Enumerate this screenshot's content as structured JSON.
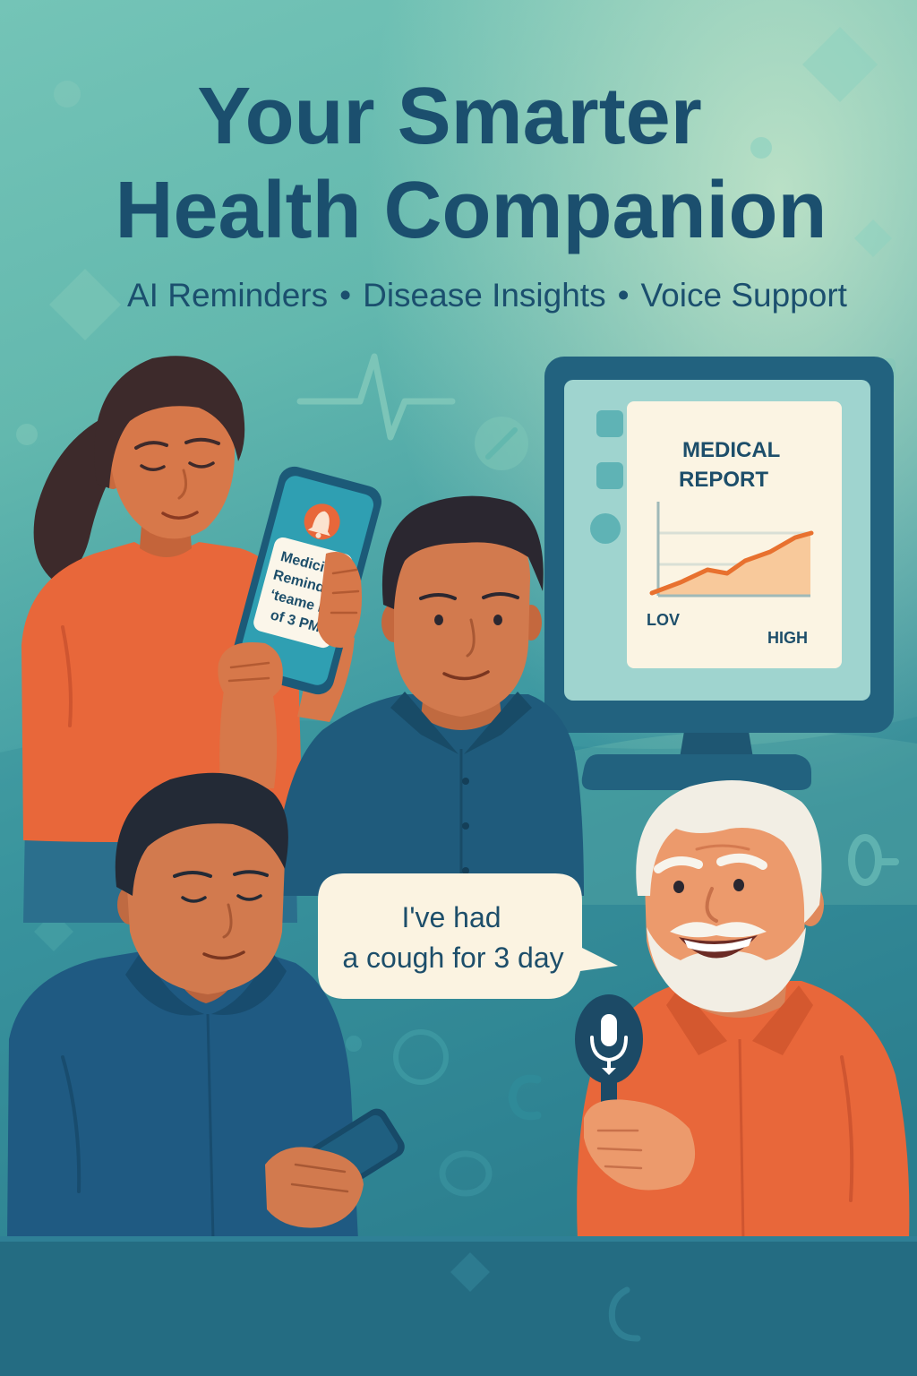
{
  "poster": {
    "title_line1": "Your Smarter",
    "title_line2": "Health Companion",
    "features": [
      "AI Reminders",
      "Disease Insights",
      "Voice Support"
    ],
    "separator": "•"
  },
  "phone_notification": {
    "icon": "bell-icon",
    "lines": [
      "Medicine",
      "Reminder",
      "‘teame in",
      "of 3 PM"
    ]
  },
  "monitor_report": {
    "title_line1": "MEDICAL",
    "title_line2": "REPORT",
    "low_label": "LOV",
    "high_label": "HIGH"
  },
  "speech_bubble": {
    "line1": "I've had",
    "line2": "a cough for 3 day"
  },
  "microphone": {
    "icon": "microphone-icon"
  },
  "colors": {
    "title_text": "#1b4f6e",
    "accent_orange": "#e8673a",
    "shirt_navy": "#1f5b7c",
    "background_teal": "#4aa5a5"
  }
}
